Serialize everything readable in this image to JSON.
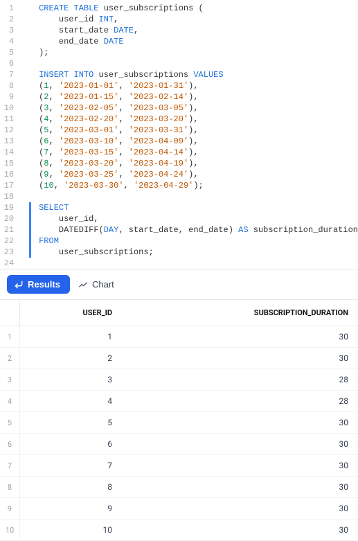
{
  "editor": {
    "highlight": {
      "start": 19,
      "end": 23
    },
    "lines": [
      [
        {
          "t": "CREATE TABLE",
          "c": "kw"
        },
        {
          "t": " user_subscriptions (",
          "c": "id"
        }
      ],
      [
        {
          "t": "    user_id ",
          "c": "id"
        },
        {
          "t": "INT",
          "c": "tk-type"
        },
        {
          "t": ",",
          "c": "id"
        }
      ],
      [
        {
          "t": "    start_date ",
          "c": "id"
        },
        {
          "t": "DATE",
          "c": "tk-type"
        },
        {
          "t": ",",
          "c": "id"
        }
      ],
      [
        {
          "t": "    end_date ",
          "c": "id"
        },
        {
          "t": "DATE",
          "c": "tk-type"
        }
      ],
      [
        {
          "t": ");",
          "c": "id"
        }
      ],
      [],
      [
        {
          "t": "INSERT INTO",
          "c": "kw"
        },
        {
          "t": " user_subscriptions ",
          "c": "id"
        },
        {
          "t": "VALUES",
          "c": "kw"
        }
      ],
      [
        {
          "t": "(",
          "c": "id"
        },
        {
          "t": "1",
          "c": "num"
        },
        {
          "t": ", ",
          "c": "id"
        },
        {
          "t": "'2023-01-01'",
          "c": "str"
        },
        {
          "t": ", ",
          "c": "id"
        },
        {
          "t": "'2023-01-31'",
          "c": "str"
        },
        {
          "t": "),",
          "c": "id"
        }
      ],
      [
        {
          "t": "(",
          "c": "id"
        },
        {
          "t": "2",
          "c": "num"
        },
        {
          "t": ", ",
          "c": "id"
        },
        {
          "t": "'2023-01-15'",
          "c": "str"
        },
        {
          "t": ", ",
          "c": "id"
        },
        {
          "t": "'2023-02-14'",
          "c": "str"
        },
        {
          "t": "),",
          "c": "id"
        }
      ],
      [
        {
          "t": "(",
          "c": "id"
        },
        {
          "t": "3",
          "c": "num"
        },
        {
          "t": ", ",
          "c": "id"
        },
        {
          "t": "'2023-02-05'",
          "c": "str"
        },
        {
          "t": ", ",
          "c": "id"
        },
        {
          "t": "'2023-03-05'",
          "c": "str"
        },
        {
          "t": "),",
          "c": "id"
        }
      ],
      [
        {
          "t": "(",
          "c": "id"
        },
        {
          "t": "4",
          "c": "num"
        },
        {
          "t": ", ",
          "c": "id"
        },
        {
          "t": "'2023-02-20'",
          "c": "str"
        },
        {
          "t": ", ",
          "c": "id"
        },
        {
          "t": "'2023-03-20'",
          "c": "str"
        },
        {
          "t": "),",
          "c": "id"
        }
      ],
      [
        {
          "t": "(",
          "c": "id"
        },
        {
          "t": "5",
          "c": "num"
        },
        {
          "t": ", ",
          "c": "id"
        },
        {
          "t": "'2023-03-01'",
          "c": "str"
        },
        {
          "t": ", ",
          "c": "id"
        },
        {
          "t": "'2023-03-31'",
          "c": "str"
        },
        {
          "t": "),",
          "c": "id"
        }
      ],
      [
        {
          "t": "(",
          "c": "id"
        },
        {
          "t": "6",
          "c": "num"
        },
        {
          "t": ", ",
          "c": "id"
        },
        {
          "t": "'2023-03-10'",
          "c": "str"
        },
        {
          "t": ", ",
          "c": "id"
        },
        {
          "t": "'2023-04-09'",
          "c": "str"
        },
        {
          "t": "),",
          "c": "id"
        }
      ],
      [
        {
          "t": "(",
          "c": "id"
        },
        {
          "t": "7",
          "c": "num"
        },
        {
          "t": ", ",
          "c": "id"
        },
        {
          "t": "'2023-03-15'",
          "c": "str"
        },
        {
          "t": ", ",
          "c": "id"
        },
        {
          "t": "'2023-04-14'",
          "c": "str"
        },
        {
          "t": "),",
          "c": "id"
        }
      ],
      [
        {
          "t": "(",
          "c": "id"
        },
        {
          "t": "8",
          "c": "num"
        },
        {
          "t": ", ",
          "c": "id"
        },
        {
          "t": "'2023-03-20'",
          "c": "str"
        },
        {
          "t": ", ",
          "c": "id"
        },
        {
          "t": "'2023-04-19'",
          "c": "str"
        },
        {
          "t": "),",
          "c": "id"
        }
      ],
      [
        {
          "t": "(",
          "c": "id"
        },
        {
          "t": "9",
          "c": "num"
        },
        {
          "t": ", ",
          "c": "id"
        },
        {
          "t": "'2023-03-25'",
          "c": "str"
        },
        {
          "t": ", ",
          "c": "id"
        },
        {
          "t": "'2023-04-24'",
          "c": "str"
        },
        {
          "t": "),",
          "c": "id"
        }
      ],
      [
        {
          "t": "(",
          "c": "id"
        },
        {
          "t": "10",
          "c": "num"
        },
        {
          "t": ", ",
          "c": "id"
        },
        {
          "t": "'2023-03-30'",
          "c": "str"
        },
        {
          "t": ", ",
          "c": "id"
        },
        {
          "t": "'2023-04-29'",
          "c": "str"
        },
        {
          "t": ");",
          "c": "id"
        }
      ],
      [],
      [
        {
          "t": "SELECT",
          "c": "kw"
        }
      ],
      [
        {
          "t": "    user_id,",
          "c": "id"
        }
      ],
      [
        {
          "t": "    ",
          "c": "id"
        },
        {
          "t": "DATEDIFF",
          "c": "fn"
        },
        {
          "t": "(",
          "c": "id"
        },
        {
          "t": "DAY",
          "c": "kw"
        },
        {
          "t": ", start_date, end_date) ",
          "c": "id"
        },
        {
          "t": "AS",
          "c": "kw"
        },
        {
          "t": " subscription_duration",
          "c": "id"
        }
      ],
      [
        {
          "t": "FROM",
          "c": "kw"
        }
      ],
      [
        {
          "t": "    user_subscriptions;",
          "c": "id"
        }
      ],
      []
    ]
  },
  "toolbar": {
    "results_label": "Results",
    "chart_label": "Chart"
  },
  "table": {
    "columns": [
      "USER_ID",
      "SUBSCRIPTION_DURATION"
    ],
    "rows": [
      {
        "n": "1",
        "user_id": "1",
        "dur": "30"
      },
      {
        "n": "2",
        "user_id": "2",
        "dur": "30"
      },
      {
        "n": "3",
        "user_id": "3",
        "dur": "28"
      },
      {
        "n": "4",
        "user_id": "4",
        "dur": "28"
      },
      {
        "n": "5",
        "user_id": "5",
        "dur": "30"
      },
      {
        "n": "6",
        "user_id": "6",
        "dur": "30"
      },
      {
        "n": "7",
        "user_id": "7",
        "dur": "30"
      },
      {
        "n": "8",
        "user_id": "8",
        "dur": "30"
      },
      {
        "n": "9",
        "user_id": "9",
        "dur": "30"
      },
      {
        "n": "10",
        "user_id": "10",
        "dur": "30"
      }
    ]
  }
}
